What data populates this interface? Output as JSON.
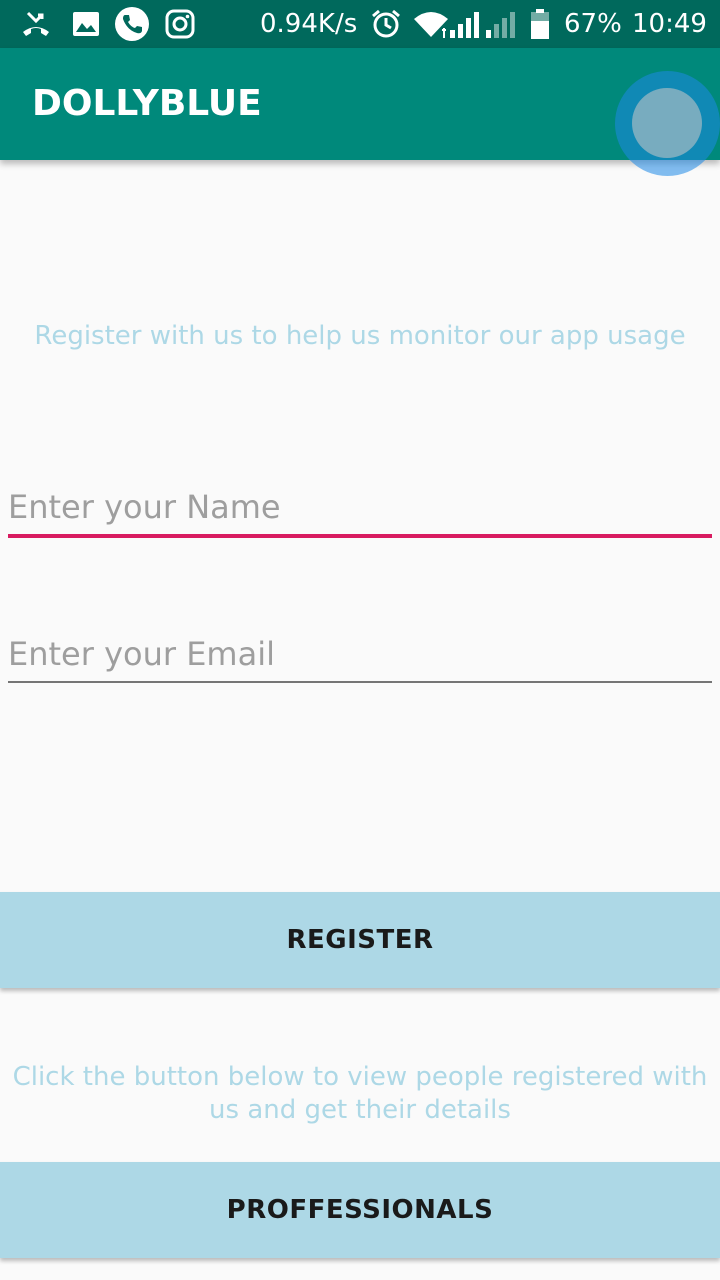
{
  "status_bar": {
    "network_speed": "0.94K/s",
    "battery_percent": "67%",
    "time": "10:49",
    "left_icons": [
      "missed-call-icon",
      "image-icon",
      "phone-icon",
      "instagram-icon"
    ],
    "right_icons": [
      "alarm-icon",
      "wifi-icon",
      "signal-icon",
      "signal-icon",
      "battery-icon"
    ]
  },
  "app_bar": {
    "title": "DOLLYBLUE",
    "background_color": "#00897b"
  },
  "main": {
    "intro_text": "Register with us to help us monitor our app usage",
    "name_field": {
      "value": "",
      "placeholder": "Enter your Name",
      "focused": true
    },
    "email_field": {
      "value": "",
      "placeholder": "Enter your Email",
      "focused": false
    },
    "register_button_label": "REGISTER",
    "info_text": "Click the button below to view people registered with us and get their details",
    "professionals_button_label": "PROFFESSIONALS"
  },
  "colors": {
    "status_bar": "#00695c",
    "accent": "#d81b60",
    "button_background": "#add8e6",
    "hint_text": "#add8e6"
  }
}
